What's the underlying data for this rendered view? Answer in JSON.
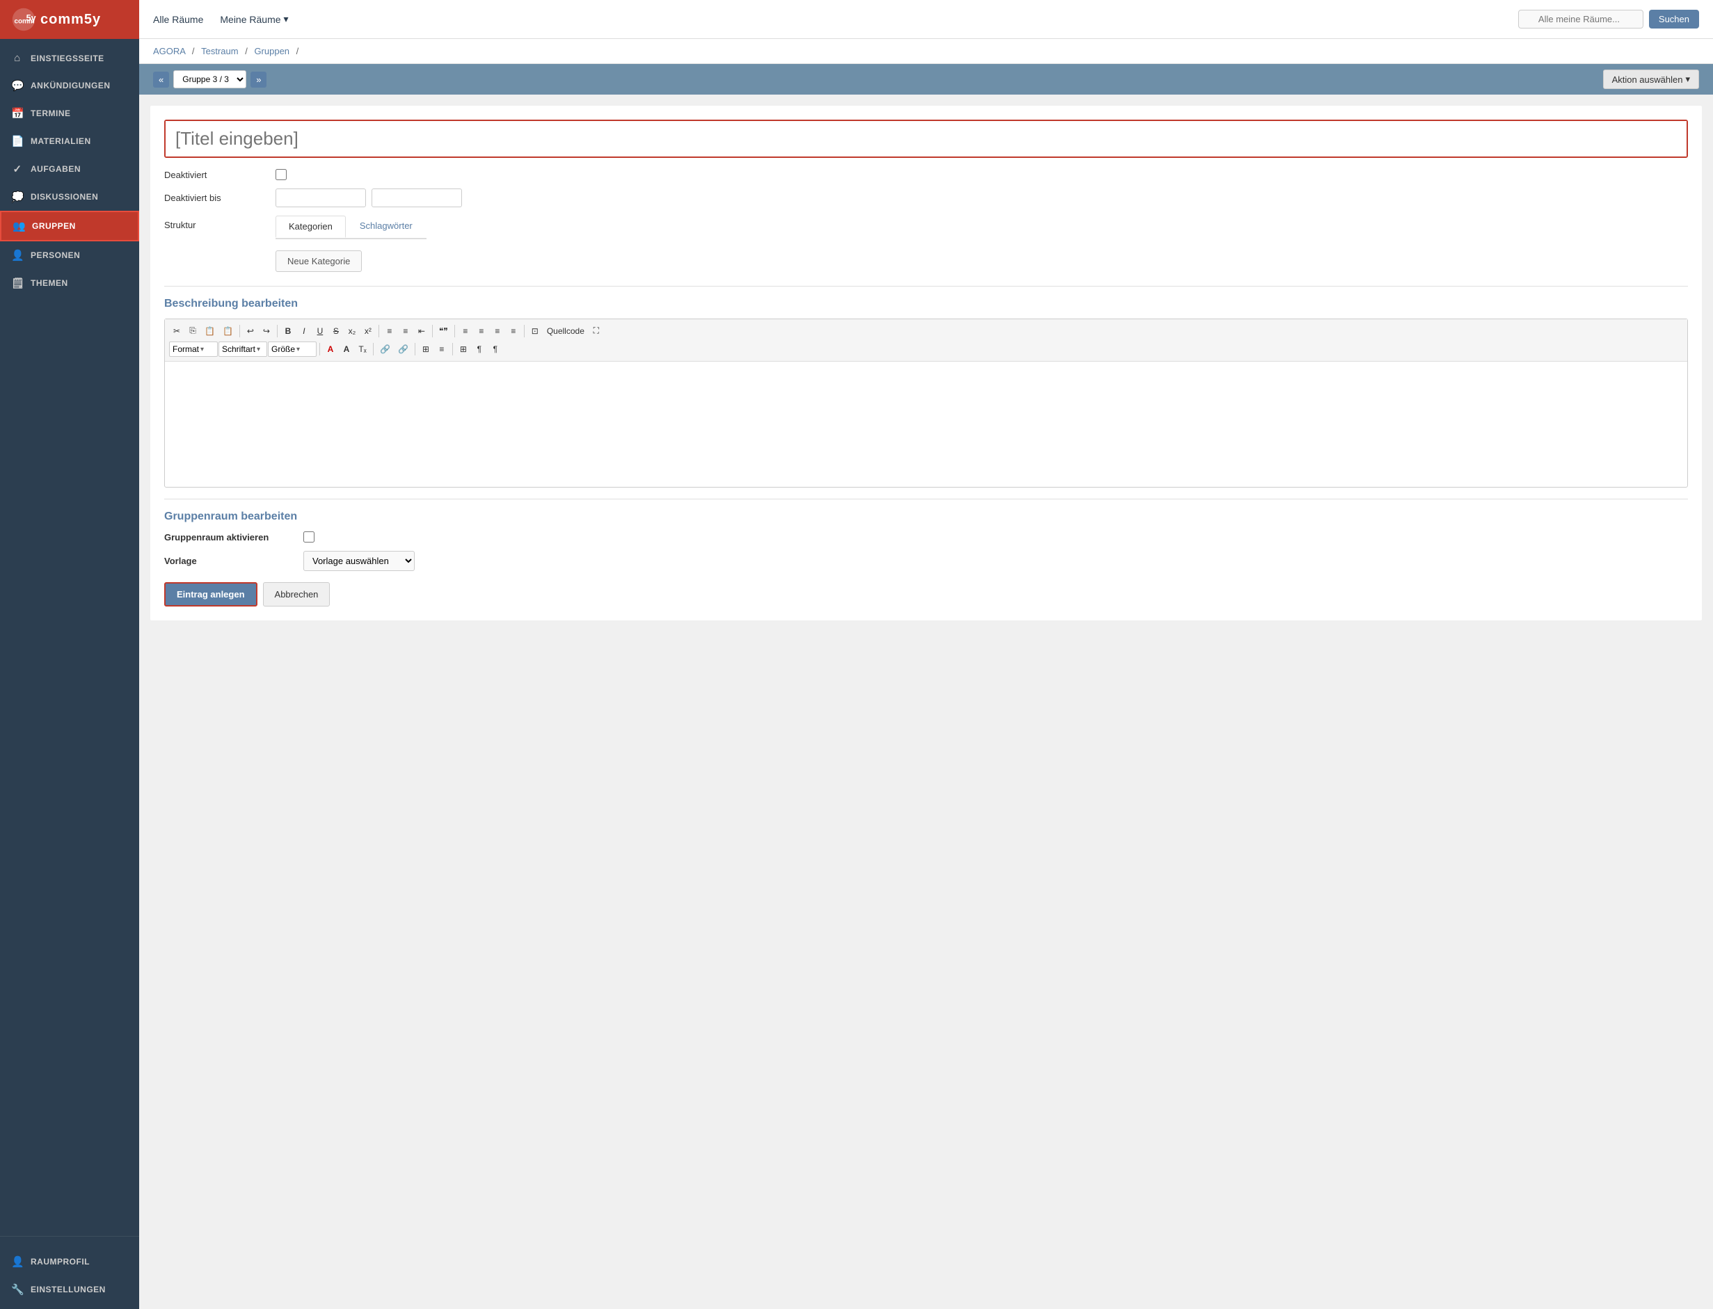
{
  "sidebar": {
    "logo": "comm5y",
    "items": [
      {
        "id": "einstiegsseite",
        "label": "Einstiegsseite",
        "icon": "⌂",
        "active": false
      },
      {
        "id": "ankündigungen",
        "label": "Ankündigungen",
        "icon": "💬",
        "active": false
      },
      {
        "id": "termine",
        "label": "Termine",
        "icon": "📅",
        "active": false
      },
      {
        "id": "materialien",
        "label": "Materialien",
        "icon": "📄",
        "active": false
      },
      {
        "id": "aufgaben",
        "label": "Aufgaben",
        "icon": "✓",
        "active": false
      },
      {
        "id": "diskussionen",
        "label": "Diskussionen",
        "icon": "💭",
        "active": false
      },
      {
        "id": "gruppen",
        "label": "Gruppen",
        "icon": "👥",
        "active": true
      },
      {
        "id": "personen",
        "label": "Personen",
        "icon": "👤",
        "active": false
      },
      {
        "id": "themen",
        "label": "Themen",
        "icon": "🗒",
        "active": false
      }
    ],
    "bottom_items": [
      {
        "id": "raumprofil",
        "label": "Raumprofil",
        "icon": "👤"
      },
      {
        "id": "einstellungen",
        "label": "Einstellungen",
        "icon": "🔧"
      }
    ]
  },
  "topbar": {
    "alle_raeume": "Alle Räume",
    "meine_raeume": "Meine Räume",
    "search_placeholder": "Alle meine Räume...",
    "search_btn": "Suchen"
  },
  "breadcrumb": {
    "parts": [
      "AGORA",
      "Testraum",
      "Gruppen",
      ""
    ]
  },
  "page_nav": {
    "prev_prev": "«",
    "prev": "<",
    "next": ">",
    "next_next": "»",
    "group_select": "Gruppe 3 / 3",
    "aktion": "Aktion auswählen"
  },
  "form": {
    "title_placeholder": "[Titel eingeben]",
    "deaktiviert_label": "Deaktiviert",
    "deaktiviert_bis_label": "Deaktiviert bis",
    "struktur_label": "Struktur",
    "tab_kategorien": "Kategorien",
    "tab_schlagwoerter": "Schlagwörter",
    "neue_kategorie_btn": "Neue Kategorie",
    "beschreibung_heading": "Beschreibung bearbeiten",
    "rte_toolbar_row1": [
      "✂",
      "⎘",
      "📋",
      "📋",
      "↩",
      "↪",
      "B",
      "I",
      "U",
      "S",
      "x₂",
      "x²",
      "≡",
      "≡",
      "⇤",
      "——",
      "❝❞",
      "≡",
      "≡",
      "≡",
      "≡",
      "⊡",
      "Quellcode",
      "⛶"
    ],
    "rte_format_label": "Format",
    "rte_schriftart_label": "Schriftart",
    "rte_groesse_label": "Größe",
    "rte_toolbar_row2_extra": [
      "A",
      "A",
      "Tx",
      "🔗",
      "🔗",
      "⊞",
      "≡",
      "⊞",
      "¶",
      "¶"
    ],
    "gruppenraum_heading": "Gruppenraum bearbeiten",
    "gruppenraum_aktivieren_label": "Gruppenraum aktivieren",
    "vorlage_label": "Vorlage",
    "vorlage_select_default": "Vorlage auswählen",
    "btn_eintrag": "Eintrag anlegen",
    "btn_abbrechen": "Abbrechen"
  }
}
